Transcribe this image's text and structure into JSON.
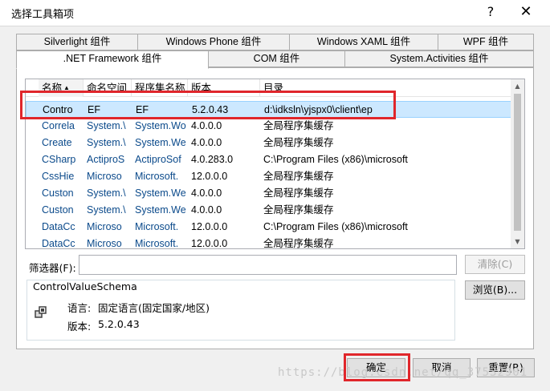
{
  "window": {
    "title": "选择工具箱项",
    "help_label": "?",
    "close_label": "✕"
  },
  "tabs_row1": [
    "Silverlight 组件",
    "Windows Phone 组件",
    "Windows XAML 组件",
    "WPF 组件"
  ],
  "tabs_row2": [
    ".NET Framework 组件",
    "COM 组件",
    "System.Activities 组件"
  ],
  "active_tab": ".NET Framework 组件",
  "list": {
    "columns": [
      "名称",
      "命名空间",
      "程序集名称",
      "版本",
      "目录"
    ],
    "sorted_column": "名称",
    "rows": [
      [
        "Contro",
        "EF",
        "EF",
        "5.2.0.43",
        "d:\\idksln\\yjspx0\\client\\ep"
      ],
      [
        "Correla",
        "System.\\",
        "System.Wo",
        "4.0.0.0",
        "全局程序集缓存"
      ],
      [
        "Create",
        "System.\\",
        "System.We",
        "4.0.0.0",
        "全局程序集缓存"
      ],
      [
        "CSharp",
        "ActiproS",
        "ActiproSof",
        "4.0.283.0",
        "C:\\Program Files (x86)\\microsoft"
      ],
      [
        "CssHie",
        "Microso",
        "Microsoft.",
        "12.0.0.0",
        "全局程序集缓存"
      ],
      [
        "Custon",
        "System.\\",
        "System.We",
        "4.0.0.0",
        "全局程序集缓存"
      ],
      [
        "Custon",
        "System.\\",
        "System.We",
        "4.0.0.0",
        "全局程序集缓存"
      ],
      [
        "DataCc",
        "Microso",
        "Microsoft.",
        "12.0.0.0",
        "C:\\Program Files (x86)\\microsoft"
      ],
      [
        "DataCc",
        "Microso",
        "Microsoft.",
        "12.0.0.0",
        "全局程序集缓存"
      ]
    ],
    "selected_row": 0
  },
  "filter": {
    "label": "筛选器(F):",
    "value": "",
    "clear_label": "清除(C)"
  },
  "info": {
    "title": "ControlValueSchema",
    "language_label": "语言:",
    "language_value": "固定语言(固定国家/地区)",
    "version_label": "版本:",
    "version_value": "5.2.0.43"
  },
  "browse_label": "浏览(B)...",
  "buttons": {
    "ok": "确定",
    "cancel": "取消",
    "reset": "重置(R)"
  },
  "watermark": "https://blog.csdn.net/qq_37532901",
  "colors": {
    "highlight_box": "#e0262b",
    "selected_row": "#cce8ff"
  }
}
